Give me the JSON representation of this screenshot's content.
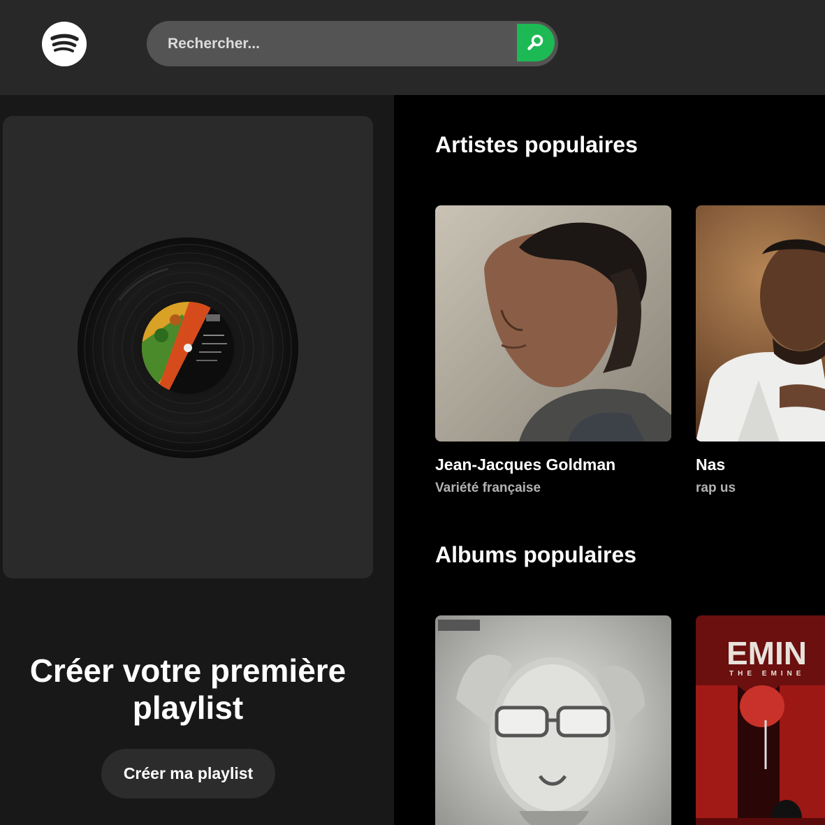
{
  "header": {
    "logo_icon": "spotify-logo-icon",
    "search": {
      "placeholder": "Rechercher...",
      "button_icon": "search-icon"
    }
  },
  "colors": {
    "accent": "#1db954",
    "header_bg": "#282828",
    "sidebar_bg": "#181818",
    "card_bg": "#2a2a2a",
    "main_bg": "#000000"
  },
  "left_panel": {
    "vinyl_icon": "vinyl-record-icon",
    "cta_title_line1": "Créer votre première",
    "cta_title_line2": "playlist",
    "cta_button": "Créer ma playlist"
  },
  "artists": {
    "title": "Artistes populaires",
    "items": [
      {
        "name": "Jean-Jacques Goldman",
        "genre": "Variété française"
      },
      {
        "name": "Nas",
        "genre": "rap us"
      }
    ]
  },
  "albums": {
    "title": "Albums populaires",
    "items": [
      {
        "cover_text": ""
      },
      {
        "cover_text": "EMIN",
        "cover_subtext": "THE EMINE"
      }
    ]
  }
}
